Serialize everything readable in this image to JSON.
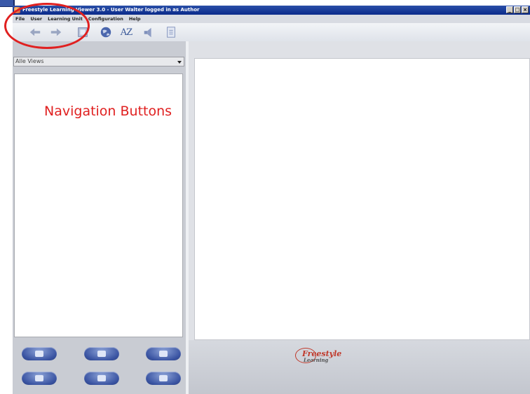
{
  "window": {
    "title": "Freestyle Learning Viewer 3.0 - User Walter logged in as Author",
    "controls": [
      "_",
      "□",
      "×"
    ]
  },
  "menu": [
    "File",
    "User",
    "Learning Unit",
    "Configuration",
    "Help"
  ],
  "toolbar": {
    "buttons": [
      {
        "name": "back-arrow-icon",
        "interactable": true
      },
      {
        "name": "forward-arrow-icon",
        "interactable": true
      },
      {
        "name": "bookmark-icon",
        "interactable": true
      },
      {
        "name": "globe-icon",
        "interactable": true
      },
      {
        "name": "az-sort-icon",
        "label": "AZ",
        "interactable": true
      },
      {
        "name": "speaker-icon",
        "interactable": true
      },
      {
        "name": "document-icon",
        "interactable": true
      }
    ]
  },
  "left_panel": {
    "views_dropdown": {
      "selected": "Alle Views"
    },
    "action_buttons": [
      "next-step-icon",
      "pause-icon",
      "notes-icon",
      "trash-icon",
      "screen-icon",
      "edit-icon"
    ]
  },
  "branding": {
    "logo_text": "Freestyle",
    "logo_sub": "Learning"
  },
  "annotation": {
    "label": "Navigation Buttons",
    "color": "#e02020"
  },
  "colors": {
    "title_bar": "#0a2a8a",
    "accent_pill": "#3b55a3",
    "logo_red": "#c0392b"
  }
}
